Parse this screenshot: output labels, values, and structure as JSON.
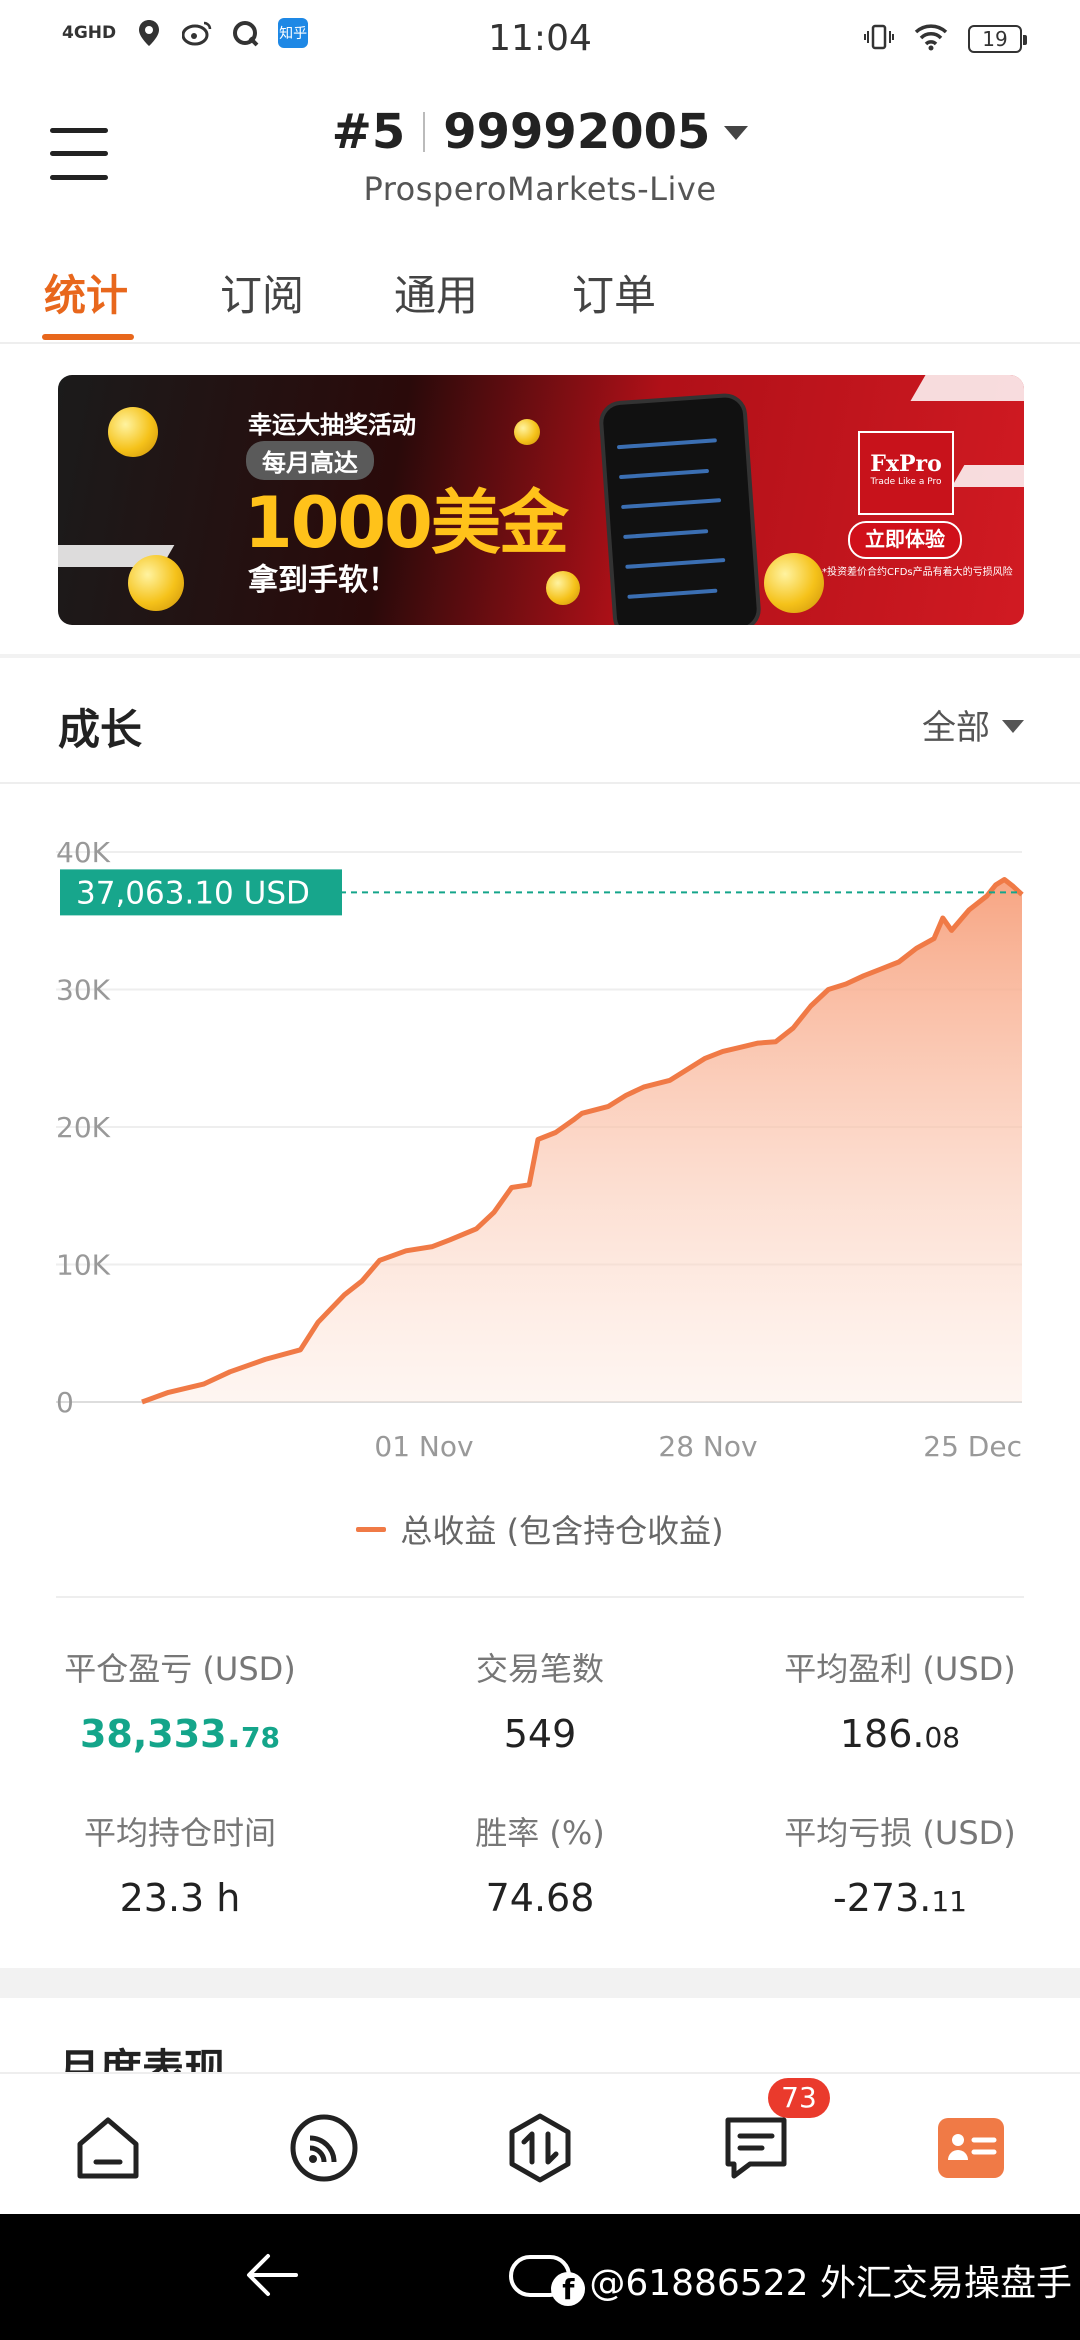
{
  "status_bar": {
    "time": "11:04",
    "network_label": "4GHD",
    "zhihu_label": "知乎",
    "battery": "19"
  },
  "header": {
    "account_number_prefix": "#5",
    "account_id": "99992005",
    "server": "ProsperoMarkets-Live"
  },
  "tabs": [
    {
      "label": "统计",
      "active": true
    },
    {
      "label": "订阅",
      "active": false
    },
    {
      "label": "通用",
      "active": false
    },
    {
      "label": "订单",
      "active": false
    }
  ],
  "banner": {
    "line1": "幸运大抽奖活动",
    "pill": "每月高达",
    "amount": "1000美金",
    "line3": "拿到手软！",
    "logo_main": "FxPro",
    "logo_sub": "Trade Like a Pro",
    "cta": "立即体验",
    "disclaimer": "*投资差价合约CFDs产品有着大的亏损风险"
  },
  "growth_section": {
    "title": "成长",
    "filter": "全部"
  },
  "chart_data": {
    "type": "area",
    "y_ticks": [
      "40K",
      "30K",
      "20K",
      "10K",
      "0"
    ],
    "ylim": [
      0,
      40000
    ],
    "x_ticks": [
      "01 Nov",
      "28 Nov",
      "25 Dec"
    ],
    "current_value_label": "37,063.10 USD",
    "current_value": 37063.1,
    "series": [
      {
        "name": "总收益 (包含持仓收益)",
        "x": [
          0,
          0.03,
          0.07,
          0.1,
          0.14,
          0.18,
          0.2,
          0.23,
          0.25,
          0.27,
          0.3,
          0.33,
          0.35,
          0.38,
          0.4,
          0.42,
          0.44,
          0.45,
          0.47,
          0.49,
          0.5,
          0.53,
          0.55,
          0.57,
          0.6,
          0.62,
          0.64,
          0.66,
          0.68,
          0.7,
          0.72,
          0.74,
          0.76,
          0.78,
          0.8,
          0.82,
          0.84,
          0.86,
          0.88,
          0.9,
          0.91,
          0.92,
          0.94,
          0.96,
          0.97,
          0.98,
          0.99,
          1.0
        ],
        "values": [
          0,
          700,
          1300,
          2200,
          3100,
          3800,
          5800,
          7800,
          8800,
          10300,
          11000,
          11300,
          11800,
          12600,
          13800,
          15600,
          15800,
          19100,
          19600,
          20500,
          21000,
          21500,
          22300,
          22900,
          23400,
          24200,
          25000,
          25500,
          25800,
          26100,
          26200,
          27200,
          28800,
          30000,
          30400,
          31000,
          31500,
          32000,
          33000,
          33700,
          35200,
          34300,
          35800,
          36800,
          37600,
          38000,
          37500,
          36900
        ]
      }
    ]
  },
  "legend": {
    "label": "总收益 (包含持仓收益)"
  },
  "stats": [
    {
      "label": "平仓盈亏 (USD)",
      "value_main": "38,333.",
      "value_decimal": "78",
      "positive": true
    },
    {
      "label": "交易笔数",
      "value_main": "549",
      "value_decimal": ""
    },
    {
      "label": "平均盈利 (USD)",
      "value_main": "186.",
      "value_decimal": "08"
    },
    {
      "label": "平均持仓时间",
      "value_main": "23.3 h",
      "value_decimal": ""
    },
    {
      "label": "胜率 (%)",
      "value_main": "74.68",
      "value_decimal": ""
    },
    {
      "label": "平均亏损 (USD)",
      "value_main": "-273.",
      "value_decimal": "11"
    }
  ],
  "monthly_section": {
    "title": "月度表现"
  },
  "bottom_nav": {
    "items": [
      "home",
      "signals",
      "trade",
      "messages",
      "profile"
    ],
    "message_badge": "73"
  },
  "watermark": "@61886522 外汇交易操盘手",
  "colors": {
    "accent": "#e8671c",
    "positive": "#14a58a",
    "line": "#f07a46",
    "badge": "#ea3a2c"
  }
}
